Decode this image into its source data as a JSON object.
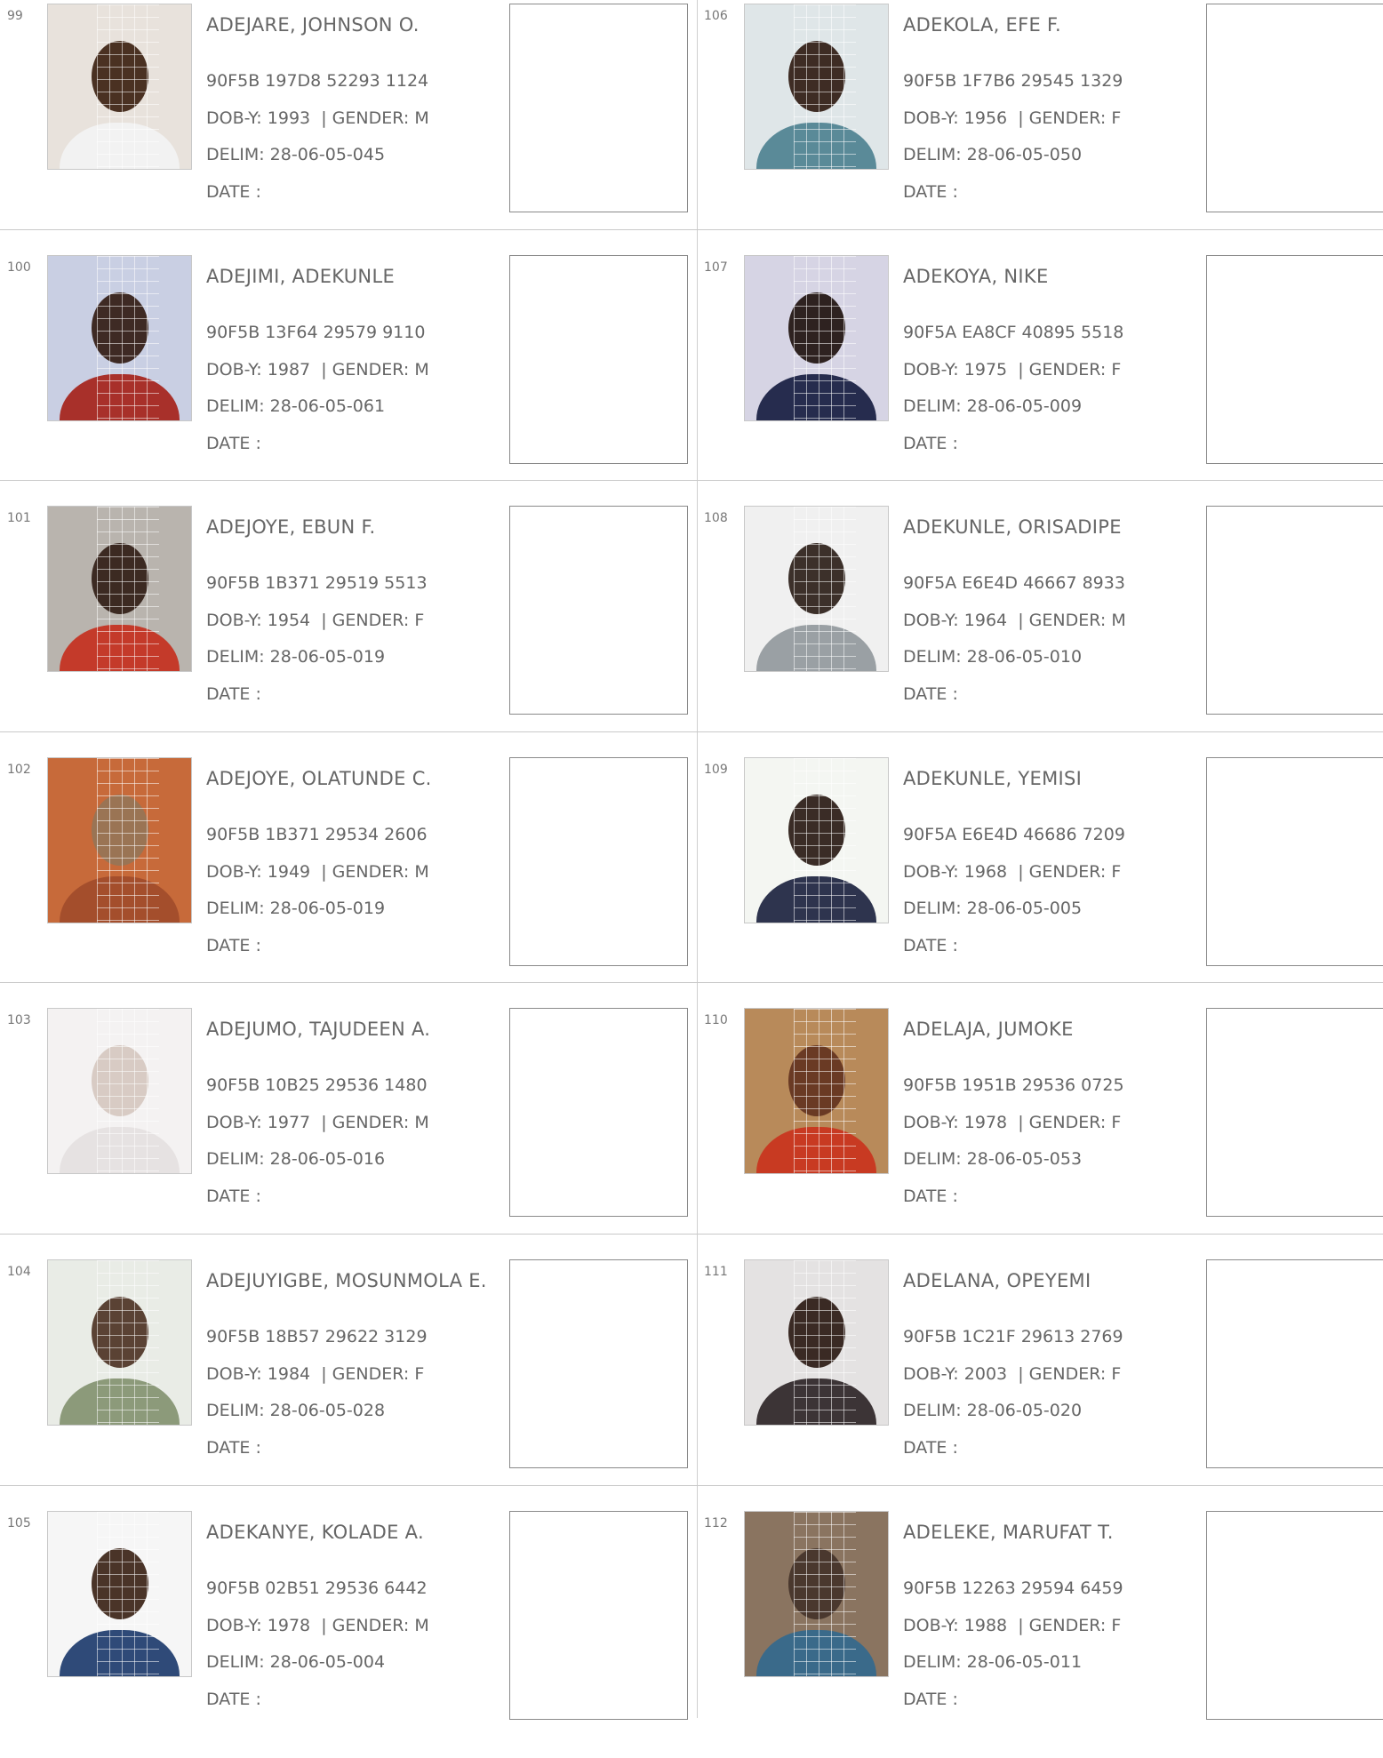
{
  "entries": [
    {
      "index": "99",
      "name": "ADEJARE, JOHNSON O.",
      "vin": "90F5B 197D8 52293 1124",
      "dob_year": "1993",
      "gender": "M",
      "delim": "28-06-05-045",
      "date": ""
    },
    {
      "index": "100",
      "name": "ADEJIMI, ADEKUNLE",
      "vin": "90F5B 13F64 29579 9110",
      "dob_year": "1987",
      "gender": "M",
      "delim": "28-06-05-061",
      "date": ""
    },
    {
      "index": "101",
      "name": "ADEJOYE, EBUN F.",
      "vin": "90F5B 1B371 29519 5513",
      "dob_year": "1954",
      "gender": "F",
      "delim": "28-06-05-019",
      "date": ""
    },
    {
      "index": "102",
      "name": "ADEJOYE, OLATUNDE C.",
      "vin": "90F5B 1B371 29534 2606",
      "dob_year": "1949",
      "gender": "M",
      "delim": "28-06-05-019",
      "date": ""
    },
    {
      "index": "103",
      "name": "ADEJUMO, TAJUDEEN A.",
      "vin": "90F5B 10B25 29536 1480",
      "dob_year": "1977",
      "gender": "M",
      "delim": "28-06-05-016",
      "date": ""
    },
    {
      "index": "104",
      "name": "ADEJUYIGBE, MOSUNMOLA E.",
      "vin": "90F5B 18B57 29622 3129",
      "dob_year": "1984",
      "gender": "F",
      "delim": "28-06-05-028",
      "date": ""
    },
    {
      "index": "105",
      "name": "ADEKANYE, KOLADE A.",
      "vin": "90F5B 02B51 29536 6442",
      "dob_year": "1978",
      "gender": "M",
      "delim": "28-06-05-004",
      "date": ""
    },
    {
      "index": "106",
      "name": "ADEKOLA, EFE F.",
      "vin": "90F5B 1F7B6 29545 1329",
      "dob_year": "1956",
      "gender": "F",
      "delim": "28-06-05-050",
      "date": ""
    },
    {
      "index": "107",
      "name": "ADEKOYA, NIKE",
      "vin": "90F5A EA8CF 40895 5518",
      "dob_year": "1975",
      "gender": "F",
      "delim": "28-06-05-009",
      "date": ""
    },
    {
      "index": "108",
      "name": "ADEKUNLE, ORISADIPE",
      "vin": "90F5A E6E4D 46667 8933",
      "dob_year": "1964",
      "gender": "M",
      "delim": "28-06-05-010",
      "date": ""
    },
    {
      "index": "109",
      "name": "ADEKUNLE, YEMISI",
      "vin": "90F5A E6E4D 46686 7209",
      "dob_year": "1968",
      "gender": "F",
      "delim": "28-06-05-005",
      "date": ""
    },
    {
      "index": "110",
      "name": "ADELAJA, JUMOKE",
      "vin": "90F5B 1951B 29536 0725",
      "dob_year": "1978",
      "gender": "F",
      "delim": "28-06-05-053",
      "date": ""
    },
    {
      "index": "111",
      "name": "ADELANA, OPEYEMI",
      "vin": "90F5B 1C21F 29613 2769",
      "dob_year": "2003",
      "gender": "F",
      "delim": "28-06-05-020",
      "date": ""
    },
    {
      "index": "112",
      "name": "ADELEKE, MARUFAT T.",
      "vin": "90F5B 12263 29594 6459",
      "dob_year": "1988",
      "gender": "F",
      "delim": "28-06-05-011",
      "date": ""
    }
  ],
  "labels": {
    "dob_prefix": "DOB-Y:",
    "gender_prefix": "| GENDER:",
    "delim_prefix": "DELIM:",
    "date_prefix": "DATE :"
  },
  "photo_palettes": [
    {
      "bg": "#e8e2dc",
      "skin": "#4a3122",
      "cloth": "#f2f2f2"
    },
    {
      "bg": "#c9cfe3",
      "skin": "#3e2a24",
      "cloth": "#a8302a"
    },
    {
      "bg": "#b9b4ae",
      "skin": "#3c2a22",
      "cloth": "#c43a2a"
    },
    {
      "bg": "#c76a3a",
      "skin": "#9a7454",
      "cloth": "#a44e2c"
    },
    {
      "bg": "#f4f2f2",
      "skin": "#d8cbc4",
      "cloth": "#e6e2e2"
    },
    {
      "bg": "#e9ece6",
      "skin": "#5a4234",
      "cloth": "#8c9a7a"
    },
    {
      "bg": "#f6f6f6",
      "skin": "#4a3428",
      "cloth": "#2f4a78"
    },
    {
      "bg": "#dfe6e8",
      "skin": "#3e2c24",
      "cloth": "#5a8a98"
    },
    {
      "bg": "#d6d4e4",
      "skin": "#2e2220",
      "cloth": "#262c4e"
    },
    {
      "bg": "#f0f0f0",
      "skin": "#3c302a",
      "cloth": "#9aa0a4"
    },
    {
      "bg": "#f4f6f2",
      "skin": "#3a2c26",
      "cloth": "#2e344e"
    },
    {
      "bg": "#b88a5a",
      "skin": "#6a3a24",
      "cloth": "#c83a22"
    },
    {
      "bg": "#e4e2e2",
      "skin": "#3a2a24",
      "cloth": "#3c3436"
    },
    {
      "bg": "#8a7460",
      "skin": "#4a382e",
      "cloth": "#3a6a8a"
    }
  ]
}
